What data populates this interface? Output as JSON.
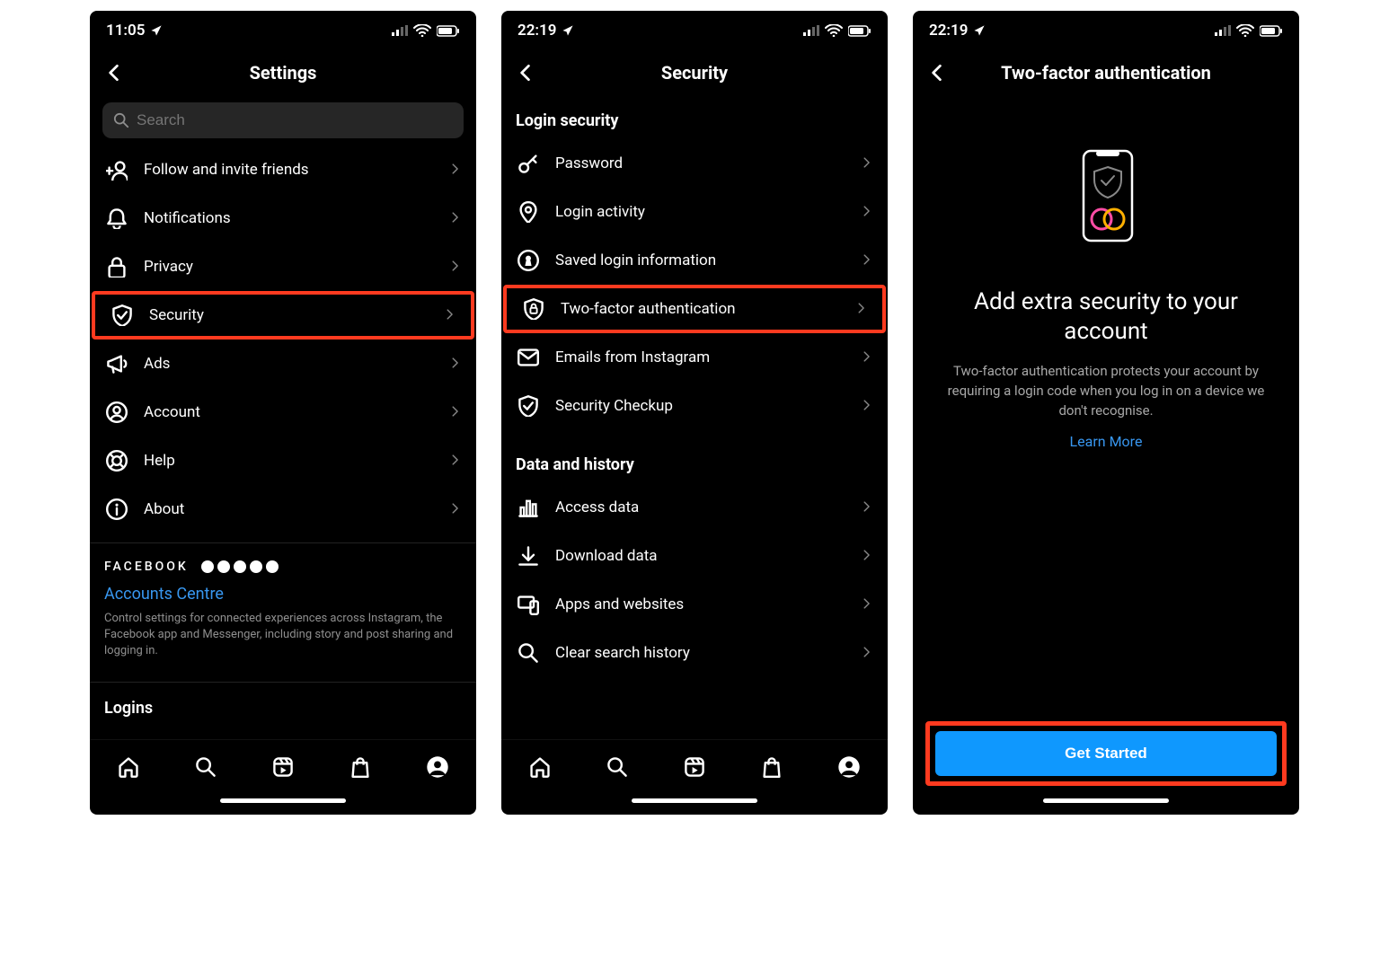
{
  "screen1": {
    "time": "11:05",
    "title": "Settings",
    "search_placeholder": "Search",
    "items": [
      {
        "label": "Follow and invite friends",
        "icon": "add-person",
        "hl": false
      },
      {
        "label": "Notifications",
        "icon": "bell",
        "hl": false
      },
      {
        "label": "Privacy",
        "icon": "lock",
        "hl": false
      },
      {
        "label": "Security",
        "icon": "shield-check",
        "hl": true
      },
      {
        "label": "Ads",
        "icon": "megaphone",
        "hl": false
      },
      {
        "label": "Account",
        "icon": "user-circle",
        "hl": false
      },
      {
        "label": "Help",
        "icon": "lifebuoy",
        "hl": false
      },
      {
        "label": "About",
        "icon": "info",
        "hl": false
      }
    ],
    "facebook_word": "FACEBOOK",
    "accounts_centre": "Accounts Centre",
    "fb_desc": "Control settings for connected experiences across Instagram, the Facebook app and Messenger, including story and post sharing and logging in.",
    "logins": "Logins"
  },
  "screen2": {
    "time": "22:19",
    "title": "Security",
    "section1": "Login security",
    "items1": [
      {
        "label": "Password",
        "icon": "key",
        "hl": false
      },
      {
        "label": "Login activity",
        "icon": "pin",
        "hl": false
      },
      {
        "label": "Saved login information",
        "icon": "keyhole",
        "hl": false
      },
      {
        "label": "Two-factor authentication",
        "icon": "shield-lock",
        "hl": true
      },
      {
        "label": "Emails from Instagram",
        "icon": "mail",
        "hl": false
      },
      {
        "label": "Security Checkup",
        "icon": "shield-check",
        "hl": false
      }
    ],
    "section2": "Data and history",
    "items2": [
      {
        "label": "Access data",
        "icon": "bar-chart",
        "hl": false
      },
      {
        "label": "Download data",
        "icon": "download",
        "hl": false
      },
      {
        "label": "Apps and websites",
        "icon": "devices",
        "hl": false
      },
      {
        "label": "Clear search history",
        "icon": "search",
        "hl": false
      }
    ]
  },
  "screen3": {
    "time": "22:19",
    "title": "Two-factor authentication",
    "headline": "Add extra security to your account",
    "desc": "Two-factor authentication protects your account by requiring a login code when you log in on a device we don't recognise.",
    "learn_more": "Learn More",
    "cta": "Get Started"
  }
}
